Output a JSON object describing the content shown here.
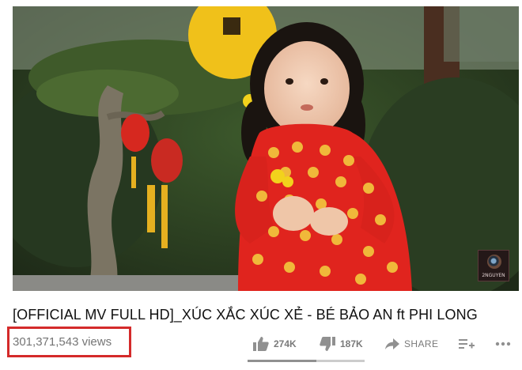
{
  "video": {
    "title": "[OFFICIAL MV FULL HD]_XÚC XẮC XÚC XẺ - BÉ BẢO AN ft PHI LONG",
    "views": "301,371,543 views",
    "watermark_icon": "camera-lens-logo-icon",
    "watermark_text": "2NGUYEN"
  },
  "actions": {
    "like": {
      "icon": "thumbs-up-icon",
      "count": "274K"
    },
    "dislike": {
      "icon": "thumbs-down-icon",
      "count": "187K"
    },
    "share": {
      "icon": "share-arrow-icon",
      "label": "SHARE"
    },
    "save": {
      "icon": "add-to-playlist-icon"
    },
    "more": {
      "icon": "more-horizontal-icon"
    }
  },
  "sentiment": {
    "like_fraction": 0.59
  },
  "colors": {
    "highlight_box": "#d42a2a",
    "meta_text": "#757575",
    "title_text": "#111111"
  }
}
